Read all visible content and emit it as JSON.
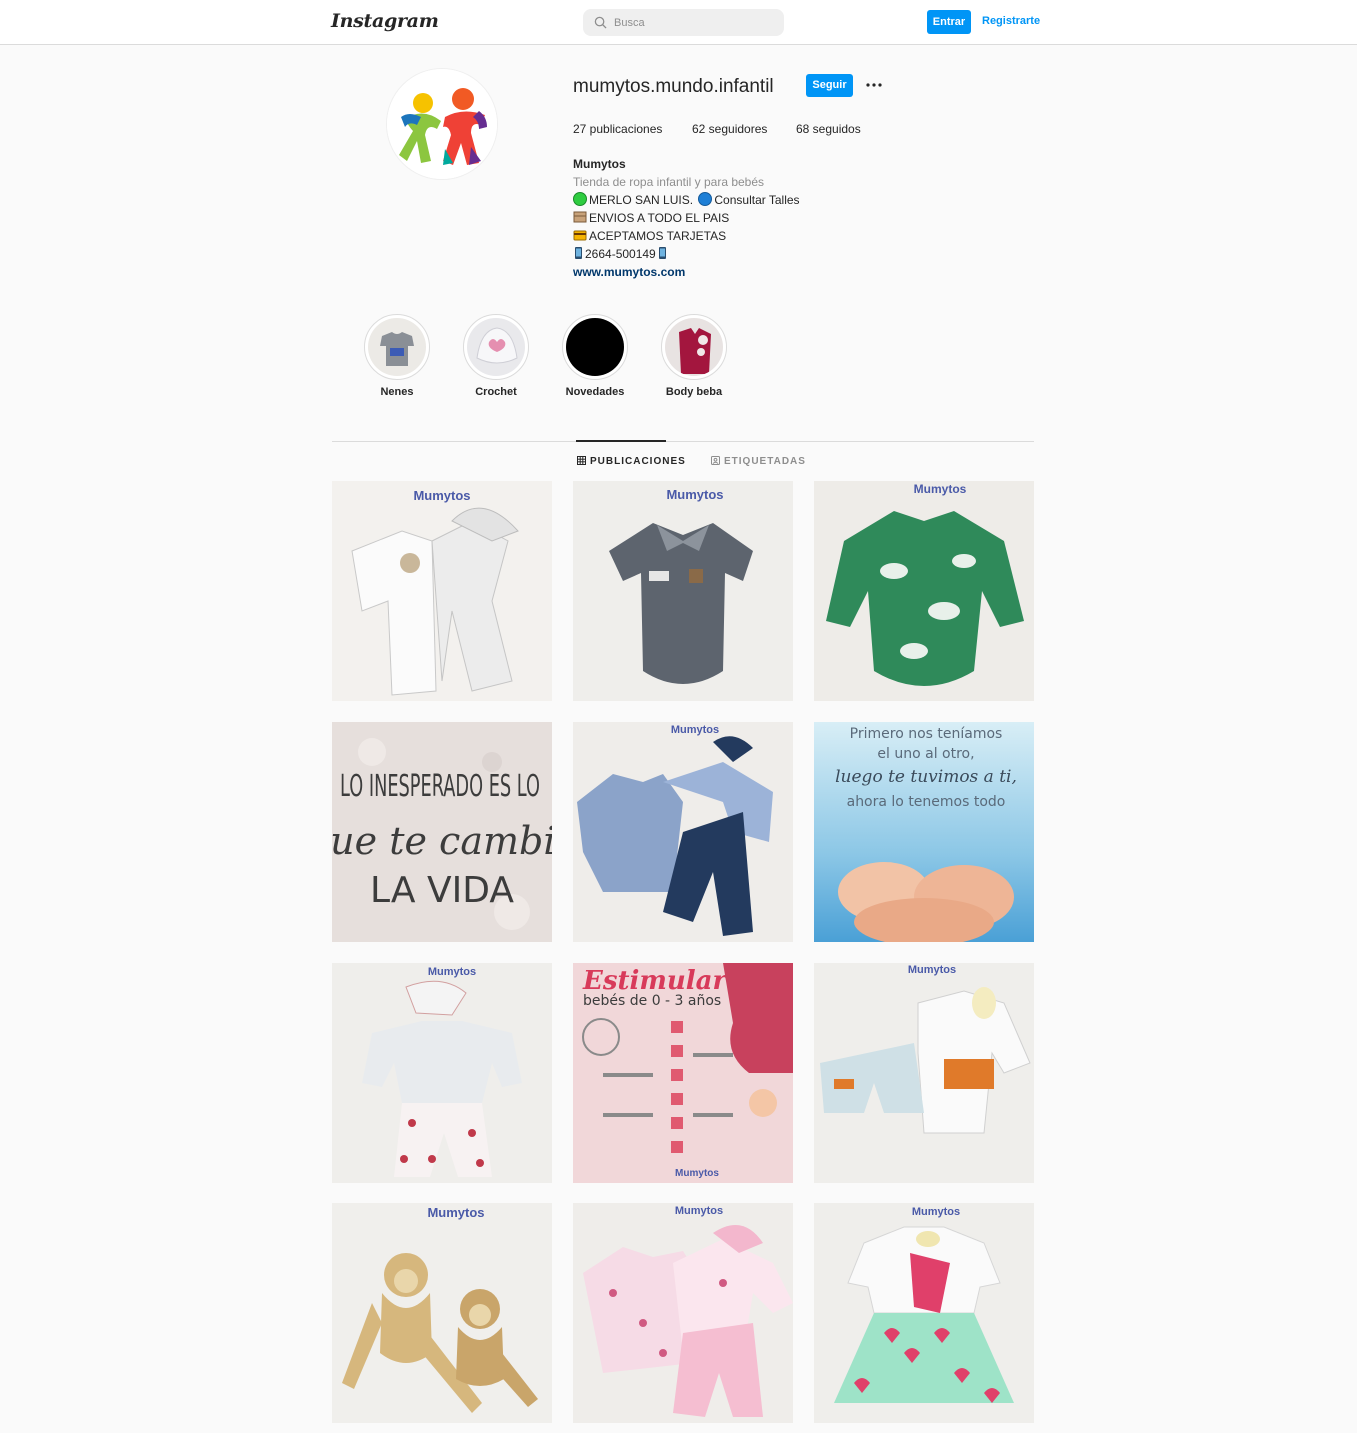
{
  "nav": {
    "logo": "Instagram",
    "search_placeholder": "Busca",
    "login_label": "Entrar",
    "signup_label": "Registrarte",
    "accent": "#0095f6"
  },
  "profile": {
    "username": "mumytos.mundo.infantil",
    "follow_label": "Seguir",
    "more_icon": "more-options-icon",
    "stats": {
      "posts": "27 publicaciones",
      "followers": "62 seguidores",
      "following": "68 seguidos"
    },
    "bio": {
      "name": "Mumytos",
      "category": "Tienda de ropa infantil y para bebés",
      "line1": "MERLO SAN LUIS.",
      "line1b": "Consultar Talles",
      "line2": "ENVIOS A TODO EL PAIS",
      "line3": "ACEPTAMOS TARJETAS",
      "line4": "2664-500149",
      "website": "www.mumytos.com"
    }
  },
  "highlights": [
    {
      "label": "Nenes"
    },
    {
      "label": "Crochet"
    },
    {
      "label": "Novedades"
    },
    {
      "label": "Body beba"
    }
  ],
  "tabs": [
    {
      "label": "PUBLICACIONES",
      "icon": "grid-icon",
      "active": true
    },
    {
      "label": "ETIQUETADAS",
      "icon": "tagged-icon",
      "active": false
    }
  ],
  "posts": [
    {
      "brand": "Mumytos",
      "alt": "baby outfit white"
    },
    {
      "brand": "Mumytos",
      "alt": "gray polo body"
    },
    {
      "brand": "Mumytos",
      "alt": "green dinosaur body"
    },
    {
      "text1": "LO INESPERADO ES LO",
      "text2": "que te cambia",
      "text3": "LA VIDA"
    },
    {
      "brand": "Mumytos",
      "alt": "blue body set"
    },
    {
      "text1": "Primero nos teníamos",
      "text2": "el uno al otro,",
      "text3": "luego te tuvimos a ti,",
      "text4": "ahora lo tenemos todo"
    },
    {
      "brand": "Mumytos",
      "alt": "floral outfit"
    },
    {
      "title": "Estimular",
      "subtitle": "bebés de 0 - 3 años",
      "brand": "Mumytos"
    },
    {
      "brand": "Mumytos",
      "alt": "animal shorts set"
    },
    {
      "brand": "Mumytos",
      "alt": "crochet monkeys"
    },
    {
      "brand": "Mumytos",
      "alt": "pink floral set"
    },
    {
      "brand": "Mumytos",
      "alt": "heart skirt set"
    }
  ]
}
